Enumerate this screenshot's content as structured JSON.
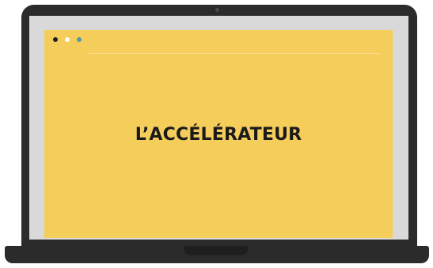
{
  "screen": {
    "headline": "L’ACCÉLÉRATEUR"
  },
  "window_controls": {
    "dots": [
      "black",
      "white",
      "teal"
    ]
  },
  "colors": {
    "window_background": "#f5cd5a",
    "laptop_body": "#2b2b2b",
    "display_frame": "#d9d9d9",
    "headline_text": "#1a1a1a"
  }
}
